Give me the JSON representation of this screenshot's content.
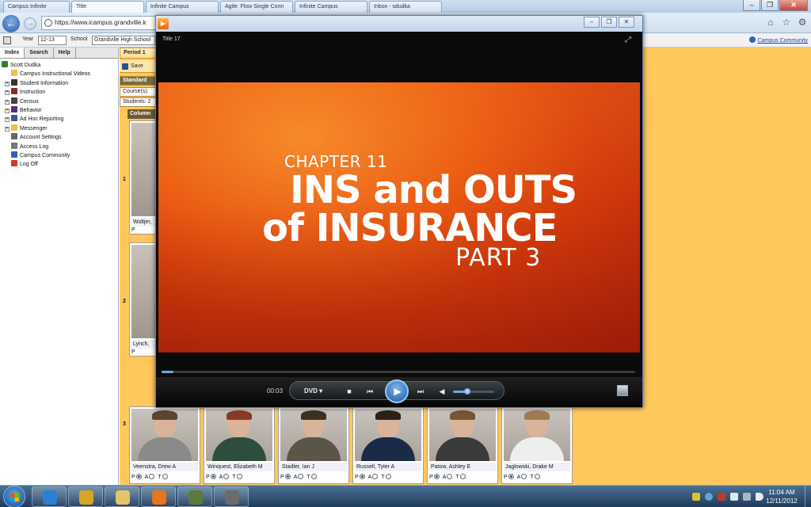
{
  "browser": {
    "url": "https://www.icampus.grandville.k",
    "tabs": [
      {
        "label": "Campus Infinite"
      },
      {
        "label": "Title"
      },
      {
        "label": "Infinite Campus"
      },
      {
        "label": "Agile: Flow Single Conn"
      },
      {
        "label": "Infinite Campus"
      },
      {
        "label": "Inbox - sdudka"
      }
    ]
  },
  "app": {
    "year_label": "Year",
    "year_value": "12-13",
    "school_label": "School",
    "school_value": "Grandville High School",
    "community_link": "Campus Community"
  },
  "sidebar": {
    "tabs": [
      "Index",
      "Search",
      "Help"
    ],
    "items": [
      {
        "label": "Scott Dudka",
        "icon": "user-icon",
        "color": "#2f7d32",
        "expandable": false
      },
      {
        "label": "Campus Instructional Videos",
        "icon": "folder-icon",
        "color": "#e8c24a",
        "expandable": false
      },
      {
        "label": "Student Information",
        "icon": "students-icon",
        "color": "#333333",
        "expandable": true
      },
      {
        "label": "Instruction",
        "icon": "book-icon",
        "color": "#8b2c2c",
        "expandable": true
      },
      {
        "label": "Census",
        "icon": "census-icon",
        "color": "#444444",
        "expandable": true
      },
      {
        "label": "Behavior",
        "icon": "behavior-icon",
        "color": "#5a2a7a",
        "expandable": true
      },
      {
        "label": "Ad Hoc Reporting",
        "icon": "report-icon",
        "color": "#3a5a8a",
        "expandable": true
      },
      {
        "label": "Messenger",
        "icon": "folder-icon",
        "color": "#e8c24a",
        "expandable": true
      },
      {
        "label": "Account Settings",
        "icon": "settings-icon",
        "color": "#666666",
        "expandable": false
      },
      {
        "label": "Access Log",
        "icon": "log-icon",
        "color": "#777777",
        "expandable": false
      },
      {
        "label": "Campus Community",
        "icon": "community-icon",
        "color": "#2a62b7",
        "expandable": false
      },
      {
        "label": "Log Off",
        "icon": "logoff-icon",
        "color": "#d03a1b",
        "expandable": false
      }
    ]
  },
  "workspace": {
    "period_tab": "Period 1",
    "save_label": "Save",
    "standard_label": "Standard",
    "course_label": "Course(s):",
    "students_label": "Students: 2",
    "column_label": "Column",
    "row_numbers": [
      "1",
      "2",
      "3"
    ],
    "partial_rows": [
      {
        "name": "Woltjer,",
        "att": "P"
      },
      {
        "name": "Lynch,",
        "att": "P"
      }
    ],
    "students": [
      {
        "name": "Veenstra, Drew A",
        "shirt": "#8a8a8a",
        "hair": "#5a4632"
      },
      {
        "name": "Winquest, Elizabeth M",
        "shirt": "#2f4d3c",
        "hair": "#8a3a22"
      },
      {
        "name": "Stadler, Ian J",
        "shirt": "#5b5548",
        "hair": "#3e2f22"
      },
      {
        "name": "Russell, Tyler A",
        "shirt": "#1c2a4a",
        "hair": "#2b2018"
      },
      {
        "name": "Patow, Ashley E",
        "shirt": "#3a3a3a",
        "hair": "#7a5434"
      },
      {
        "name": "Jaglowski, Drake M",
        "shirt": "#eeeeee",
        "hair": "#a07a52"
      }
    ],
    "att_labels": {
      "present": "P",
      "absent": "A",
      "tardy": "T"
    }
  },
  "player": {
    "title": "Title 17",
    "video": {
      "chapter": "CHAPTER 11",
      "line1": "INS and OUTS",
      "line2": "of INSURANCE",
      "part": "PART 3"
    },
    "time": "00:03",
    "mode_label": "DVD ▾",
    "progress": 0.025,
    "volume": 0.35
  },
  "taskbar": {
    "apps": [
      {
        "name": "internet-explorer",
        "color": "#2a7fd4"
      },
      {
        "name": "chrome",
        "color": "#d9a423"
      },
      {
        "name": "file-explorer",
        "color": "#e5c46a"
      },
      {
        "name": "media-player",
        "color": "#e8751a"
      },
      {
        "name": "app-5",
        "color": "#5d7a3c"
      },
      {
        "name": "app-6",
        "color": "#6b6b6b"
      }
    ],
    "clock_time": "11:04 AM",
    "clock_date": "12/11/2012"
  }
}
